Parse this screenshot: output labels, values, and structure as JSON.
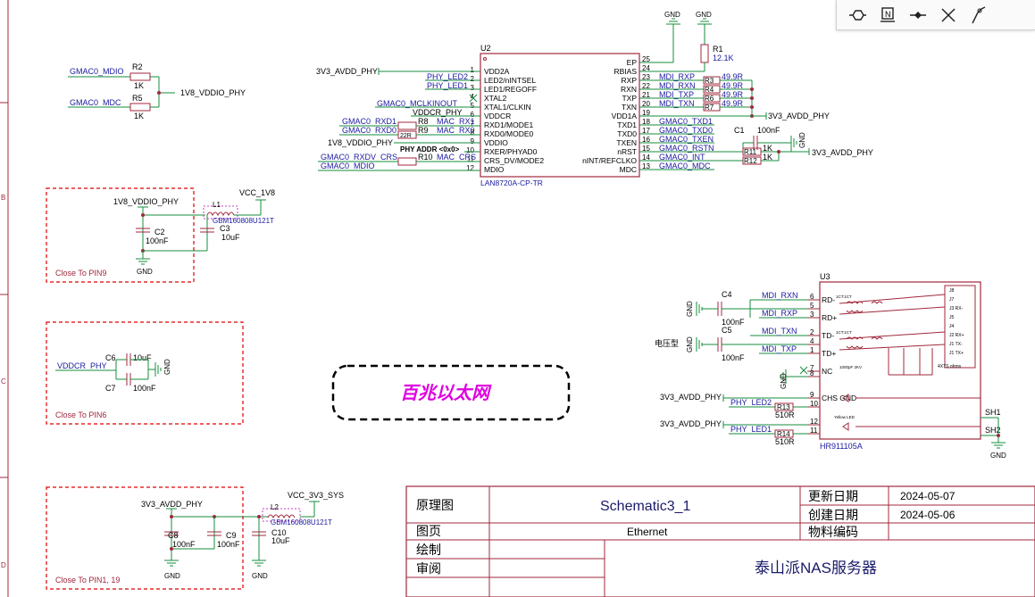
{
  "zones": [
    "B",
    "C",
    "D"
  ],
  "chips": {
    "u2": {
      "ref": "U2",
      "name": "LAN8720A-CP-TR",
      "left_pins": [
        {
          "num": "1",
          "name": "VDD2A"
        },
        {
          "num": "2",
          "name": "LED2/nINTSEL"
        },
        {
          "num": "3",
          "name": "LED1/REGOFF"
        },
        {
          "num": "4",
          "name": "XTAL2"
        },
        {
          "num": "5",
          "name": "XTAL1/CLKIN"
        },
        {
          "num": "6",
          "name": "VDDCR"
        },
        {
          "num": "7",
          "name": "RXD1/MODE1"
        },
        {
          "num": "8",
          "name": "RXD0/MODE0"
        },
        {
          "num": "9",
          "name": "VDDIO"
        },
        {
          "num": "10",
          "name": "RXER/PHYAD0"
        },
        {
          "num": "11",
          "name": "CRS_DV/MODE2"
        },
        {
          "num": "12",
          "name": "MDIO"
        }
      ],
      "right_pins": [
        {
          "num": "25",
          "name": "EP"
        },
        {
          "num": "24",
          "name": "RBIAS"
        },
        {
          "num": "23",
          "name": "RXP"
        },
        {
          "num": "22",
          "name": "RXN"
        },
        {
          "num": "21",
          "name": "TXP"
        },
        {
          "num": "20",
          "name": "TXN"
        },
        {
          "num": "19",
          "name": "VDD1A"
        },
        {
          "num": "18",
          "name": "TXD1"
        },
        {
          "num": "17",
          "name": "TXD0"
        },
        {
          "num": "16",
          "name": "TXEN"
        },
        {
          "num": "15",
          "name": "nRST"
        },
        {
          "num": "14",
          "name": "nINT/REFCLKO"
        },
        {
          "num": "13",
          "name": "MDC"
        }
      ]
    },
    "u3": {
      "ref": "U3",
      "name": "HR911105A",
      "left_pins": [
        {
          "num": "6",
          "name": "RD-"
        },
        {
          "num": "5",
          "name": ""
        },
        {
          "num": "3",
          "name": "RD+"
        },
        {
          "num": "2",
          "name": "TD-"
        },
        {
          "num": "4",
          "name": ""
        },
        {
          "num": "1",
          "name": "TD+"
        },
        {
          "num": "7",
          "name": "NC"
        },
        {
          "num": "8",
          "name": ""
        },
        {
          "num": "9",
          "name": "CHS GND"
        },
        {
          "num": "10",
          "name": ""
        },
        {
          "num": "12",
          "name": ""
        },
        {
          "num": "11",
          "name": ""
        }
      ],
      "inner_labels": [
        "1CT:1CT",
        "1CT:1CT",
        "1000pF 2KV",
        "Yellow LED"
      ],
      "right_labels": [
        "J8",
        "J7",
        "J3 RX-",
        "J5",
        "J4",
        "J2 RX+",
        "J1 TX-",
        "J1 TX+"
      ],
      "side_text": "4XTS ohms",
      "shield_pins": [
        "SH1",
        "SH2"
      ]
    }
  },
  "components": {
    "r1": {
      "ref": "R1",
      "value": "12.1K"
    },
    "r2": {
      "ref": "R2",
      "value": "1K"
    },
    "r5": {
      "ref": "R5",
      "value": "1K"
    },
    "r3": {
      "ref": "R3",
      "value": "49.9R"
    },
    "r4": {
      "ref": "R4",
      "value": "49.9R"
    },
    "r6": {
      "ref": "R6",
      "value": "49.9R"
    },
    "r7": {
      "ref": "R7",
      "value": "49.9R"
    },
    "r8": {
      "ref": "R8",
      "value": "22R"
    },
    "r9": {
      "ref": "R9",
      "value": "22R"
    },
    "r10": {
      "ref": "R10",
      "value": "22R"
    },
    "r11": {
      "ref": "R11",
      "value": "1K"
    },
    "r12": {
      "ref": "R12",
      "value": "1K"
    },
    "r13": {
      "ref": "R13",
      "value": "510R"
    },
    "r14": {
      "ref": "R14",
      "value": "510R"
    },
    "c1": {
      "ref": "C1",
      "value": "100nF"
    },
    "c2": {
      "ref": "C2",
      "value": "100nF"
    },
    "c3": {
      "ref": "C3",
      "value": "10uF"
    },
    "c4": {
      "ref": "C4",
      "value": "100nF"
    },
    "c5": {
      "ref": "C5",
      "value": "100nF"
    },
    "c6": {
      "ref": "C6",
      "value": "10uF"
    },
    "c7": {
      "ref": "C7",
      "value": "100nF"
    },
    "c8": {
      "ref": "C8",
      "value": "100nF"
    },
    "c9": {
      "ref": "C9",
      "value": "100nF"
    },
    "c10": {
      "ref": "C10",
      "value": "10uF"
    },
    "l1": {
      "ref": "L1",
      "value": "GBM160808U121T"
    },
    "l2": {
      "ref": "L2",
      "value": "GBM160808U121T"
    }
  },
  "nets": {
    "gmac0_mdio": "GMAC0_MDIO",
    "gmac0_mdc": "GMAC0_MDC",
    "v1v8_vddio_phy": "1V8_VDDIO_PHY",
    "v3v3_avdd_phy": "3V3_AVDD_PHY",
    "phy_led2": "PHY_LED2",
    "phy_led1": "PHY_LED1",
    "gmac0_mclkinout": "GMAC0_MCLKINOUT",
    "vddcr_phy": "VDDCR_PHY",
    "gmac0_rxd1": "GMAC0_RXD1",
    "gmac0_rxd0": "GMAC0_RXD0",
    "mac_rx1": "MAC_RX1",
    "mac_rx0": "MAC_RX0",
    "mac_crs": "MAC_CRS",
    "gmac0_rxdv_crs": "GMAC0_RXDV_CRS",
    "phy_addr": "PHY ADDR <0x0>",
    "mdi_rxp": "MDI_RXP",
    "mdi_rxn": "MDI_RXN",
    "mdi_txp": "MDI_TXP",
    "mdi_txn": "MDI_TXN",
    "gmac0_txd1": "GMAC0_TXD1",
    "gmac0_txd0": "GMAC0_TXD0",
    "gmac0_txen": "GMAC0_TXEN",
    "gmac0_rstn": "GMAC0_RSTN",
    "gmac0_int": "GMAC0_INT",
    "vcc_1v8": "VCC_1V8",
    "vcc_3v3_sys": "VCC_3V3_SYS",
    "gnd": "GND"
  },
  "notes": {
    "close_pin9": "Close To PIN9",
    "close_pin6": "Close To PIN6",
    "close_pin1_19": "Close To PIN1, 19",
    "voltage_type": "电压型",
    "banner": "百兆以太网"
  },
  "title_block": {
    "label_schematic": "原理图",
    "schematic_name": "Schematic3_1",
    "label_page": "图页",
    "page_name": "Ethernet",
    "label_drawn": "绘制",
    "label_review": "审阅",
    "label_update_date": "更新日期",
    "update_date": "2024-05-07",
    "label_create_date": "创建日期",
    "create_date": "2024-05-06",
    "label_material": "物料编码",
    "project_name": "泰山派NAS服务器"
  },
  "toolbar": {
    "tools": [
      "bus-entry-icon",
      "net-label-icon",
      "pin-icon",
      "no-connect-icon",
      "probe-icon"
    ]
  },
  "colors": {
    "wire": "#148c3c",
    "part": "#a0283c",
    "netlabel": "#1a1aa0",
    "text": "#000000",
    "banner": "#e000e0",
    "border": "#a0283c"
  }
}
